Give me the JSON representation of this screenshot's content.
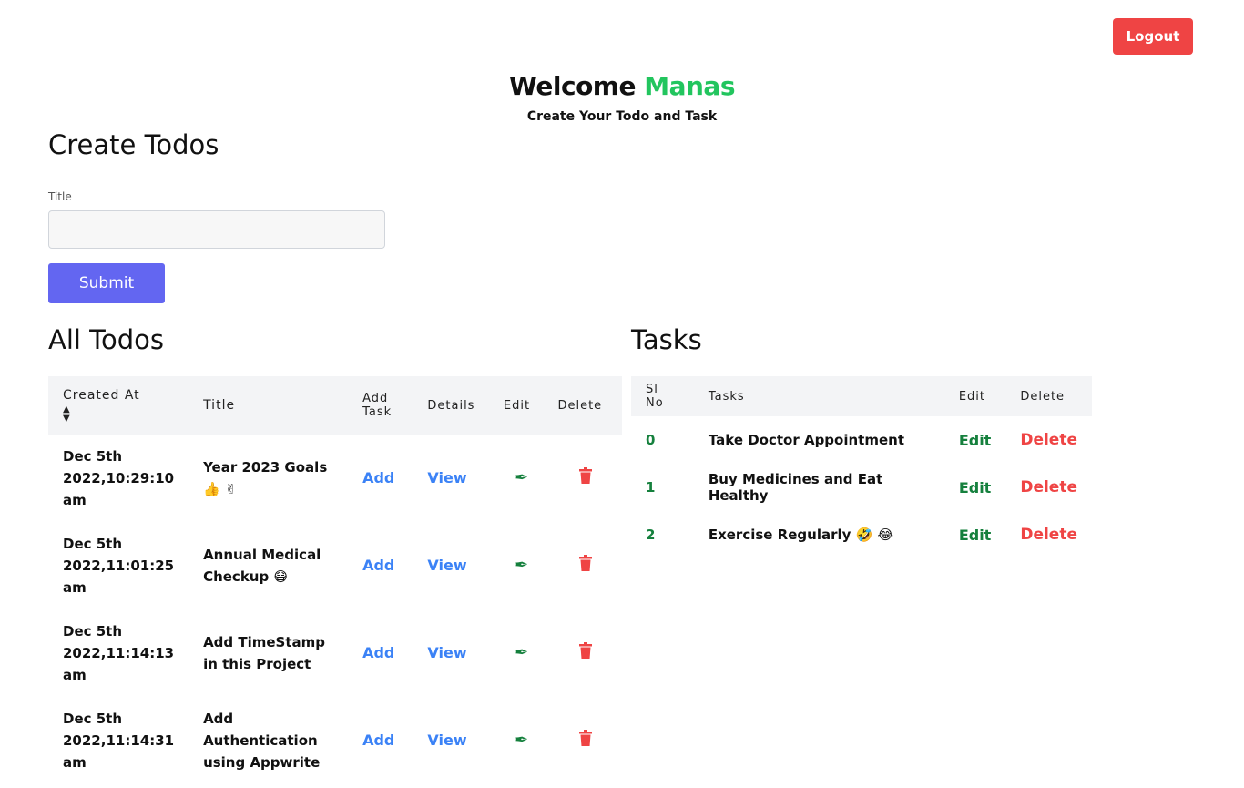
{
  "header": {
    "logout_label": "Logout",
    "welcome_prefix": "Welcome",
    "user_name": "Manas",
    "subtitle": "Create Your Todo and Task"
  },
  "create": {
    "heading": "Create Todos",
    "title_label": "Title",
    "title_value": "",
    "submit_label": "Submit"
  },
  "todos": {
    "heading": "All Todos",
    "columns": {
      "created_at": "Created At",
      "title": "Title",
      "add_task": "Add Task",
      "details": "Details",
      "edit": "Edit",
      "delete": "Delete"
    },
    "rows": [
      {
        "created_at": "Dec 5th 2022,10:29:10 am",
        "title": "Year 2023 Goals 👍 ✌",
        "add": "Add",
        "view": "View"
      },
      {
        "created_at": "Dec 5th 2022,11:01:25 am",
        "title": "Annual Medical Checkup 😷",
        "add": "Add",
        "view": "View"
      },
      {
        "created_at": "Dec 5th 2022,11:14:13 am",
        "title": "Add TimeStamp in this Project",
        "add": "Add",
        "view": "View"
      },
      {
        "created_at": "Dec 5th 2022,11:14:31 am",
        "title": "Add Authentication using Appwrite",
        "add": "Add",
        "view": "View"
      }
    ]
  },
  "tasks": {
    "heading": "Tasks",
    "columns": {
      "sl_no": "Sl No",
      "tasks": "Tasks",
      "edit": "Edit",
      "delete": "Delete"
    },
    "rows": [
      {
        "sl": "0",
        "task": "Take Doctor Appointment",
        "edit": "Edit",
        "delete": "Delete"
      },
      {
        "sl": "1",
        "task": "Buy Medicines and Eat Healthy",
        "edit": "Edit",
        "delete": "Delete"
      },
      {
        "sl": "2",
        "task": "Exercise Regularly 🤣 😂",
        "edit": "Edit",
        "delete": "Delete"
      }
    ]
  },
  "icons": {
    "sort": "sort-icon",
    "edit": "pen-icon",
    "delete": "trash-icon"
  },
  "colors": {
    "logout": "#ef4444",
    "accent_name": "#22c55e",
    "submit": "#6366f1",
    "link": "#3b82f6",
    "edit": "#15803d",
    "delete": "#ef4444"
  }
}
